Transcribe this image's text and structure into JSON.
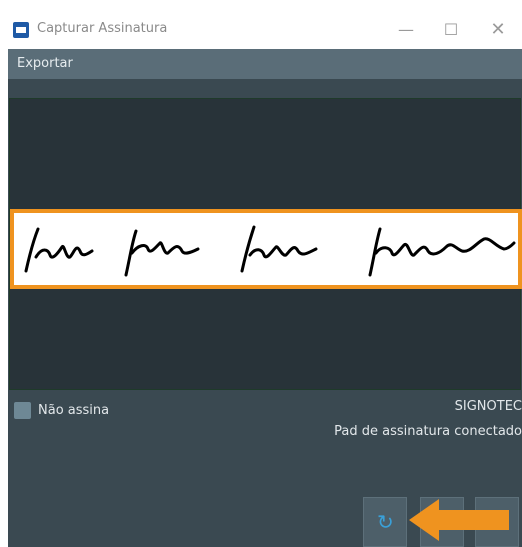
{
  "window": {
    "title": "Capturar Assinatura",
    "icon": "window-app-icon",
    "controls": {
      "minimize": "—",
      "maximize": "☐",
      "close": "✕"
    }
  },
  "menu": {
    "items": [
      {
        "label": "Exportar"
      }
    ]
  },
  "checkbox": {
    "label": "Não assina",
    "checked": false
  },
  "device": {
    "brand": "SIGNOTEC",
    "status": "Pad de assinatura conectado"
  },
  "buttons": [
    {
      "name": "refresh",
      "icon": "refresh-icon",
      "glyph": "↻"
    },
    {
      "name": "button-2",
      "icon": "unknown-icon"
    },
    {
      "name": "button-3",
      "icon": "unknown-icon"
    }
  ],
  "colors": {
    "accent": "#ef931f",
    "panel": "#3a4951",
    "canvas": "#283339",
    "menubar": "#5a6d78",
    "refresh": "#3aa0d8"
  }
}
